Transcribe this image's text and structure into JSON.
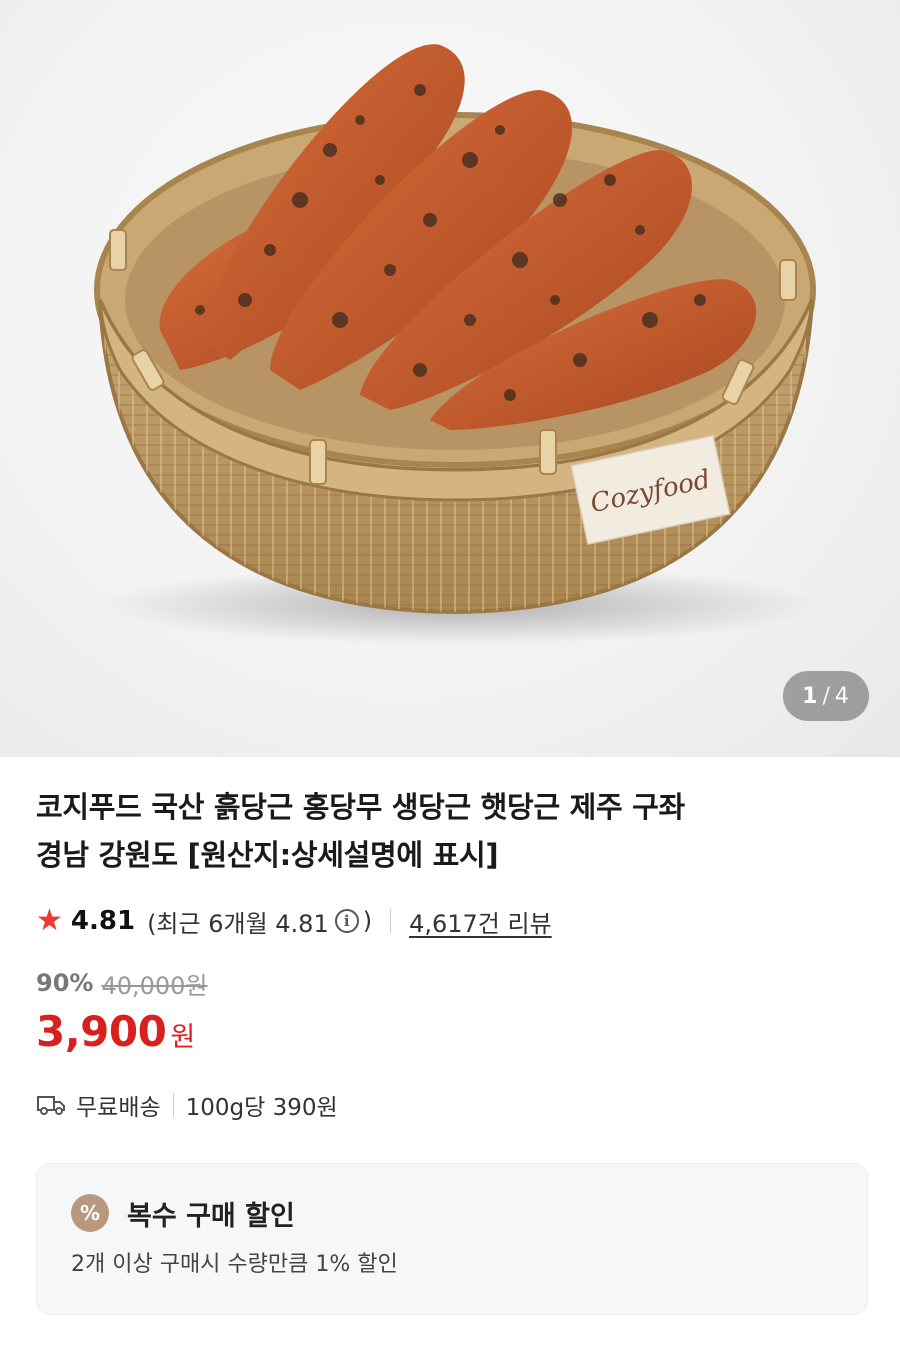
{
  "gallery": {
    "brand_label": "Cozyfood",
    "current_index": "1",
    "separator": "/",
    "total": "4"
  },
  "product": {
    "title_line1": "코지푸드 국산 흙당근 홍당무 생당근 햇당근 제주 구좌",
    "title_line2": "경남 강원도 [원산지:상세설명에 표시]",
    "rating": "4.81",
    "recent_rating_prefix": "(최근 6개월 4.81",
    "recent_rating_suffix": ")",
    "review_count": "4,617건 리뷰",
    "discount_rate": "90%",
    "original_price": "40,000원",
    "sale_price": "3,900",
    "currency": "원",
    "shipping": "무료배송",
    "unit_price": "100g당 390원"
  },
  "promo": {
    "badge": "%",
    "title": "복수 구매 할인",
    "description": "2개 이상 구매시 수량만큼 1% 할인"
  },
  "colors": {
    "price_red": "#d9201f",
    "star_red": "#f0362e",
    "promo_badge": "#b99880"
  }
}
